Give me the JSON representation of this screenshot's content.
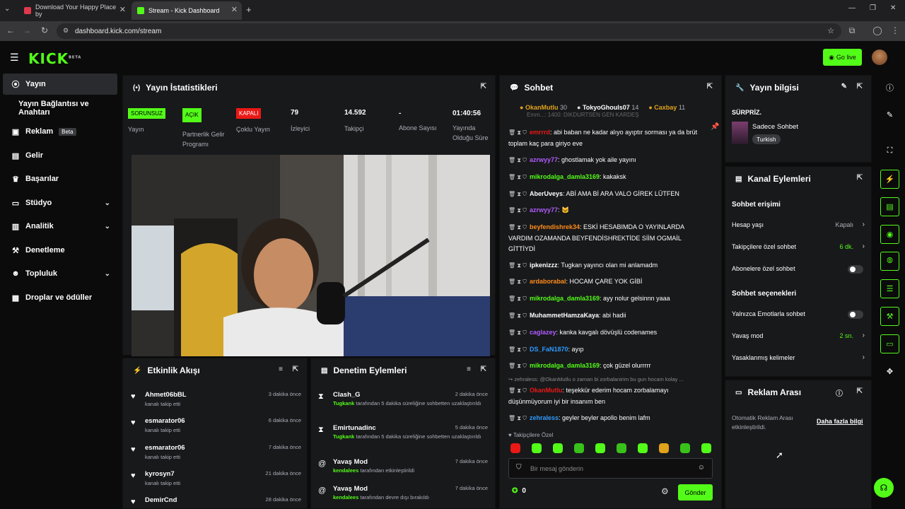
{
  "browser": {
    "tabs": [
      {
        "title": "Download Your Happy Place by",
        "active": false,
        "favicon_color": "#e0394b"
      },
      {
        "title": "Stream - Kick Dashboard",
        "active": true,
        "favicon_color": "#53fc18"
      }
    ],
    "url": "dashboard.kick.com/stream"
  },
  "app": {
    "logo": "KICK",
    "logo_sup": "BETA",
    "go_live": "Go live",
    "accent": "#53fc18"
  },
  "sidebar": {
    "items": [
      {
        "label": "Yayın",
        "icon": "stream-icon",
        "active": true
      },
      {
        "label": "Yayın Bağlantısı ve Anahtarı",
        "icon": "",
        "active": false
      },
      {
        "label": "Reklam",
        "icon": "ad-icon",
        "badge": "Beta"
      },
      {
        "label": "Gelir",
        "icon": "revenue-icon"
      },
      {
        "label": "Başarılar",
        "icon": "trophy-icon"
      },
      {
        "label": "Stüdyo",
        "icon": "studio-icon",
        "expand": true
      },
      {
        "label": "Analitik",
        "icon": "analytics-icon",
        "expand": true
      },
      {
        "label": "Denetleme",
        "icon": "moderation-icon"
      },
      {
        "label": "Topluluk",
        "icon": "community-icon",
        "expand": true
      },
      {
        "label": "Droplar ve ödüller",
        "icon": "drops-icon"
      }
    ]
  },
  "stats": {
    "title": "Yayın İstatistikleri",
    "items": [
      {
        "tag": "SORUNSUZ",
        "tag_color": "#53fc18",
        "label": "Yayın"
      },
      {
        "tag": "AÇIK",
        "tag_color": "#53fc18",
        "label": "Partnerlik Gelir Programı"
      },
      {
        "tag": "KAPALI",
        "tag_color": "#e91916",
        "label": "Çoklu Yayın"
      },
      {
        "value": "79",
        "label": "İzleyici"
      },
      {
        "value": "14.592",
        "label": "Takipçi"
      },
      {
        "value": "-",
        "label": "Abone Sayısı"
      },
      {
        "value": "01:40:56",
        "label": "Yayında Olduğu Süre"
      }
    ]
  },
  "activity": {
    "title": "Etkinlik Akışı",
    "items": [
      {
        "name": "Ahmet06bBL",
        "sub": "kanalı takip etti",
        "time": "3 dakika önce"
      },
      {
        "name": "esmarator06",
        "sub": "kanalı takip etti",
        "time": "6 dakika önce"
      },
      {
        "name": "esmarator06",
        "sub": "kanalı takip etti",
        "time": "7 dakika önce"
      },
      {
        "name": "kyrosyn7",
        "sub": "kanalı takip etti",
        "time": "21 dakika önce"
      },
      {
        "name": "DemirCnd",
        "sub": "",
        "time": "28 dakika önce"
      }
    ]
  },
  "moderation": {
    "title": "Denetim Eylemleri",
    "items": [
      {
        "name": "Clash_G",
        "actor": "Tugkank",
        "sub": "tarafından 5 dakika süreliğine sohbetten uzaklaştırıldı",
        "time": "2 dakika önce",
        "icon": "hourglass-icon"
      },
      {
        "name": "Emirtunadinc",
        "actor": "Tugkank",
        "sub": "tarafından 5 dakika süreliğine sohbetten uzaklaştırıldı",
        "time": "5 dakika önce",
        "icon": "hourglass-icon"
      },
      {
        "name": "Yavaş Mod",
        "actor": "kendalees",
        "sub": "tarafından etkinleştirildi",
        "time": "7 dakika önce",
        "icon": "snail-icon"
      },
      {
        "name": "Yavaş Mod",
        "actor": "kendalees",
        "sub": "tarafından devre dışı bırakıldı",
        "time": "7 dakika önce",
        "icon": "snail-icon"
      }
    ]
  },
  "chat": {
    "title": "Sohbet",
    "pinned": [
      {
        "name": "OkanMutlu",
        "count": "30",
        "color": "#e0a21b"
      },
      {
        "name": "TokyoGhouls07",
        "count": "14",
        "color": "#fff"
      },
      {
        "name": "Caxbay",
        "count": "11",
        "color": "#e0a21b"
      }
    ],
    "messages": [
      {
        "user": "emrrrd",
        "color": "#e91916",
        "text": ": abi baban ne kadar alıyo ayıptır sorması ya da brüt toplam kaç para giriyo eve"
      },
      {
        "user": "azrwyy77",
        "color": "#b05cff",
        "text": ": ghostlamak yok aile yayını"
      },
      {
        "user": "mikrodalga_damla3169",
        "color": "#53fc18",
        "text": ": kakaksk"
      },
      {
        "user": "AberUveys",
        "color": "#fff",
        "text": ": ABİ AMA Bİ ARA VALO GİREK LÜTFEN"
      },
      {
        "user": "azrwyy77",
        "color": "#b05cff",
        "text": ": 🐱"
      },
      {
        "user": "beyfendishrek34",
        "color": "#ff8c1a",
        "text": ": ESKİ HESABIMDA O YAYINLARDA VARDIM OZAMANDA BEYFENDİSHREKTİDE SİİM OGMAİL GİTTİYDİ"
      },
      {
        "user": "ipkenizzz",
        "color": "#fff",
        "text": ": Tugkan yayıncı olan mi anlamadm"
      },
      {
        "user": "ardaborabal",
        "color": "#ff8c1a",
        "text": ": HOCAM ÇARE YOK GİBİ"
      },
      {
        "user": "mikrodalga_damla3169",
        "color": "#53fc18",
        "text": ": ayy nolur gelsinnn yaaa"
      },
      {
        "user": "MuhammetHamzaKaya",
        "color": "#fff",
        "text": ": abi hadii"
      },
      {
        "user": "caglazey",
        "color": "#b05cff",
        "text": ": kanka kavgalı dövüşlü codenames"
      },
      {
        "user": "DS_FaN1870",
        "color": "#2f9bff",
        "text": ": ayıp"
      },
      {
        "user": "mikrodalga_damla3169",
        "color": "#53fc18",
        "text": ": çok güzel olurrrrr"
      },
      {
        "user": "OkanMutlu",
        "color": "#e91916",
        "text": ": teşekkür ederim hocam zorbalamayı düşünmüyorum iyi bir insanım ben"
      },
      {
        "user": "zehraless",
        "color": "#2f9bff",
        "text": ": geyler beyler apollo benim lafm"
      }
    ],
    "reply_preview": "↪ zehraless: @OkanMutlu o zaman bi zorbalanirim bu gun hocam kolay ...",
    "partial_top": "Emm...: 1400: DIKDURTSEN GEN KARDEŞ",
    "followers_only": "Takipçilere Özel",
    "input_placeholder": "Bir mesaj gönderin",
    "points": "0",
    "send": "Gönder"
  },
  "stream_info": {
    "title": "Yayın bilgisi",
    "stream_title": "SÜRPRİZ.",
    "category": "Sadece Sohbet",
    "language": "Turkish"
  },
  "channel_actions": {
    "title": "Kanal Eylemleri",
    "chat_access": "Sohbet erişimi",
    "rows": [
      {
        "label": "Hesap yaşı",
        "value": "Kapalı",
        "kind": "arrow"
      },
      {
        "label": "Takipçilere özel sohbet",
        "value": "6 dk.",
        "kind": "arrow",
        "green": true
      },
      {
        "label": "Abonelere özel sohbet",
        "kind": "toggle"
      }
    ],
    "chat_options": "Sohbet seçenekleri",
    "rows2": [
      {
        "label": "Yalnızca Emotlarla sohbet",
        "kind": "toggle"
      },
      {
        "label": "Yavaş mod",
        "value": "2 sn.",
        "kind": "arrow",
        "green": true
      },
      {
        "label": "Yasaklanmış kelimeler",
        "kind": "arrow"
      }
    ]
  },
  "ad_break": {
    "title": "Reklam Arası",
    "text": "Otomatik Reklam Arası etkinleştirildi.",
    "link": "Daha fazla bilgi"
  }
}
